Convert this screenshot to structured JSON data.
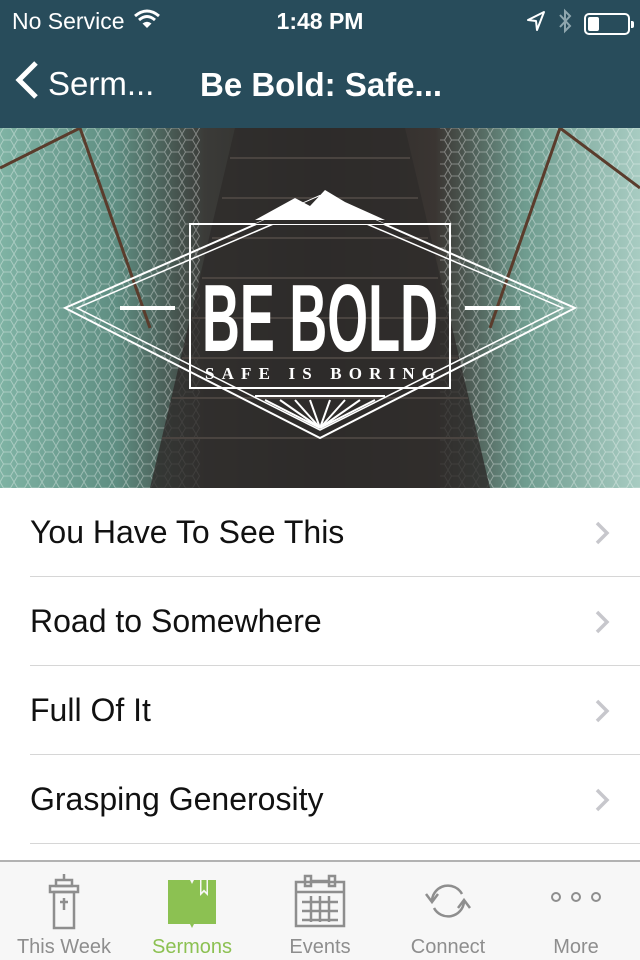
{
  "status_bar": {
    "carrier": "No Service",
    "time": "1:48 PM",
    "battery_level": 0.3,
    "icons": [
      "wifi-icon",
      "location-arrow-icon",
      "bluetooth-icon",
      "battery-icon"
    ]
  },
  "nav": {
    "back_label": "Serm...",
    "title": "Be Bold: Safe..."
  },
  "banner": {
    "title": "BE BOLD",
    "subtitle": "SAFE IS BORING"
  },
  "list": {
    "items": [
      {
        "label": "You Have To See This"
      },
      {
        "label": "Road to Somewhere"
      },
      {
        "label": "Full Of It"
      },
      {
        "label": "Grasping Generosity"
      }
    ]
  },
  "tab_bar": {
    "active_color": "#8cc152",
    "inactive_color": "#8e8e8e",
    "tabs": [
      {
        "label": "This Week",
        "icon": "pulpit-icon",
        "active": false
      },
      {
        "label": "Sermons",
        "icon": "book-icon",
        "active": true
      },
      {
        "label": "Events",
        "icon": "calendar-icon",
        "active": false
      },
      {
        "label": "Connect",
        "icon": "sync-icon",
        "active": false
      },
      {
        "label": "More",
        "icon": "more-dots-icon",
        "active": false
      }
    ]
  },
  "colors": {
    "header_bg": "#284c5b",
    "separator": "#d6d6d6",
    "chevron": "#c7c7cc"
  }
}
